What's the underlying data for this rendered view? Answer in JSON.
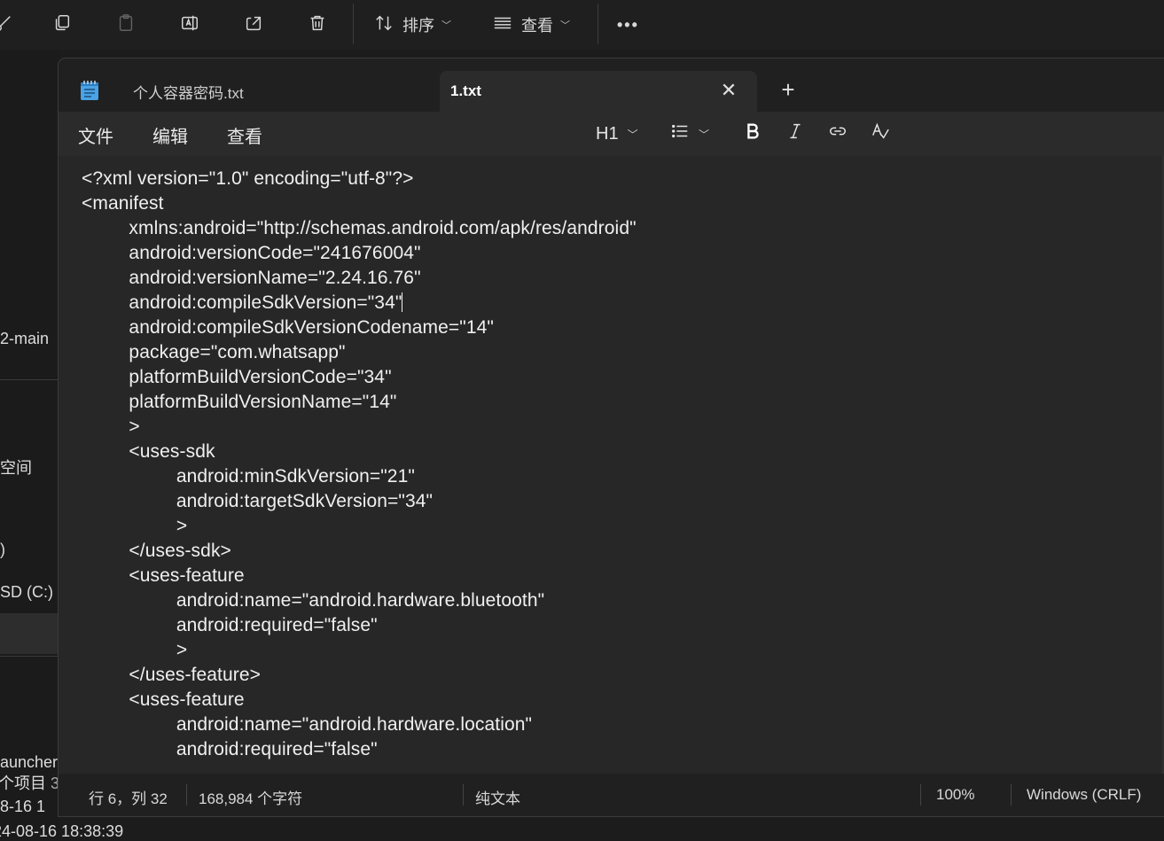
{
  "explorer": {
    "toolbar": {
      "cut_icon": "scissors-icon",
      "copy_icon": "copy-icon",
      "paste_icon": "paste-icon",
      "rename_icon": "rename-icon",
      "share_icon": "share-icon",
      "delete_icon": "trash-icon",
      "sort_label": "排序",
      "view_label": "查看",
      "more_label": "•••"
    },
    "side_items": [
      "2-main",
      "空间",
      ")",
      "SD (C:)",
      "auncher"
    ],
    "status": {
      "items_label": "个项目",
      "items_count": "3",
      "date1": "8-16 1",
      "date2": "24-08-16 18:38:39"
    }
  },
  "notepad": {
    "tabs": [
      {
        "label": "个人容器密码.txt",
        "active": false
      },
      {
        "label": "1.txt",
        "active": true
      }
    ],
    "new_tab_label": "+",
    "close_label": "✕",
    "menu": {
      "file": "文件",
      "edit": "编辑",
      "view": "查看"
    },
    "format": {
      "heading": "H1",
      "list_icon": "list-icon",
      "bold_icon": "bold-icon",
      "italic_icon": "italic-icon",
      "link_icon": "link-icon",
      "spell_icon": "spellcheck-icon"
    },
    "lines": [
      "<?xml version=\"1.0\" encoding=\"utf-8\"?>",
      "<manifest",
      "         xmlns:android=\"http://schemas.android.com/apk/res/android\"",
      "         android:versionCode=\"241676004\"",
      "         android:versionName=\"2.24.16.76\"",
      "         android:compileSdkVersion=\"34\"",
      "         android:compileSdkVersionCodename=\"14\"",
      "         package=\"com.whatsapp\"",
      "         platformBuildVersionCode=\"34\"",
      "         platformBuildVersionName=\"14\"",
      "         >",
      "         <uses-sdk",
      "                  android:minSdkVersion=\"21\"",
      "                  android:targetSdkVersion=\"34\"",
      "                  >",
      "         </uses-sdk>",
      "         <uses-feature",
      "                  android:name=\"android.hardware.bluetooth\"",
      "                  android:required=\"false\"",
      "                  >",
      "         </uses-feature>",
      "         <uses-feature",
      "                  android:name=\"android.hardware.location\"",
      "                  android:required=\"false\""
    ],
    "status": {
      "position": "行 6，列 32",
      "char_count": "168,984 个字符",
      "format": "纯文本",
      "zoom": "100%",
      "line_ending": "Windows (CRLF)"
    }
  }
}
